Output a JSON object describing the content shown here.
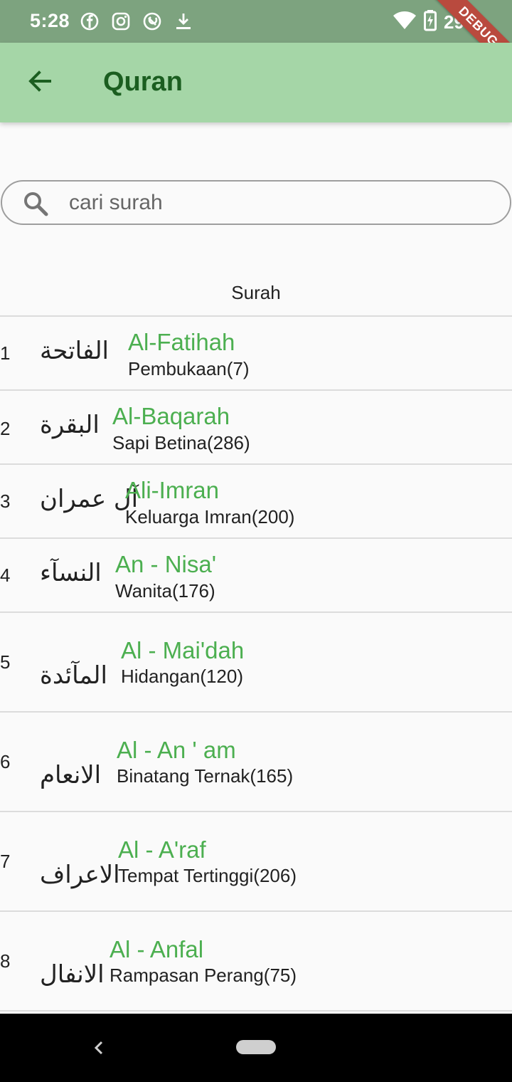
{
  "status_bar": {
    "time": "5:28",
    "battery": "29%",
    "icons_left": [
      "facebook-icon",
      "instagram-icon",
      "notification-icon",
      "download-icon"
    ],
    "icons_right": [
      "wifi-icon",
      "battery-charging-icon"
    ]
  },
  "debug_banner": "DEBUG",
  "app_bar": {
    "title": "Quran",
    "back_icon": "arrow-back-icon",
    "background": "#a5d6a7",
    "title_color": "#1b5e20"
  },
  "search": {
    "placeholder": "cari surah",
    "value": ""
  },
  "list": {
    "header": "Surah",
    "name_color": "#4caf50",
    "items": [
      {
        "number": "1",
        "arabic": "الفاتحة",
        "name": "Al-Fatihah",
        "meaning": "Pembukaan(7)"
      },
      {
        "number": "2",
        "arabic": "البقرة",
        "name": "Al-Baqarah",
        "meaning": "Sapi Betina(286)"
      },
      {
        "number": "3",
        "arabic": "آل عمران",
        "name": "Ali-Imran",
        "meaning": "Keluarga Imran(200)"
      },
      {
        "number": "4",
        "arabic": "النسآء",
        "name": "An - Nisa'",
        "meaning": "Wanita(176)"
      },
      {
        "number": "5",
        "arabic": "المآئدة",
        "name": "Al - Mai'dah",
        "meaning": "Hidangan(120)"
      },
      {
        "number": "6",
        "arabic": "الانعام",
        "name": "Al - An ' am",
        "meaning": "Binatang Ternak(165)"
      },
      {
        "number": "7",
        "arabic": "الاعراف",
        "name": "Al - A'raf",
        "meaning": "Tempat Tertinggi(206)"
      },
      {
        "number": "8",
        "arabic": "الانفال",
        "name": "Al - Anfal",
        "meaning": "Rampasan Perang(75)"
      }
    ]
  },
  "nav_bar": {
    "icons": [
      "nav-back-icon",
      "home-pill-icon"
    ]
  }
}
